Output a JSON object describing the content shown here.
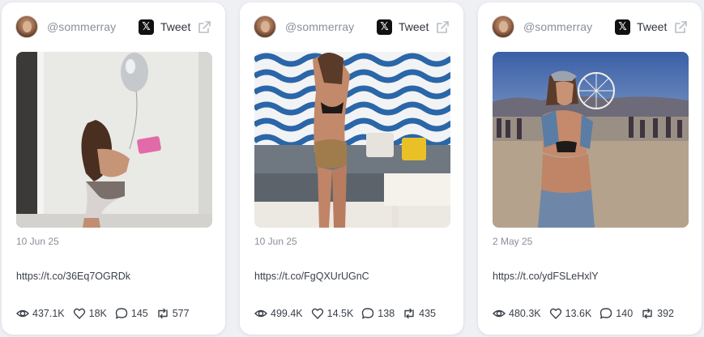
{
  "cards": [
    {
      "handle": "@sommerray",
      "tweet_label": "Tweet",
      "date": "10 Jun 25",
      "link": "https://t.co/36Eq7OGRDk",
      "views": "437.1K",
      "likes": "18K",
      "replies": "145",
      "retweets": "577",
      "photo_theme": "white-wall-balloon"
    },
    {
      "handle": "@sommerray",
      "tweet_label": "Tweet",
      "date": "10 Jun 25",
      "link": "https://t.co/FgQXUrUGnC",
      "views": "499.4K",
      "likes": "14.5K",
      "replies": "138",
      "retweets": "435",
      "photo_theme": "blue-wave-wall-lounge"
    },
    {
      "handle": "@sommerray",
      "tweet_label": "Tweet",
      "date": "2 May 25",
      "link": "https://t.co/ydFSLeHxlY",
      "views": "480.3K",
      "likes": "13.6K",
      "replies": "140",
      "retweets": "392",
      "photo_theme": "festival-ferris-wheel"
    }
  ],
  "icons": {
    "x_logo": "𝕏",
    "views": "eye-icon",
    "likes": "heart-icon",
    "replies": "comment-icon",
    "retweets": "retweet-icon",
    "external": "external-link-icon"
  },
  "colors": {
    "background": "#eef0f4",
    "card": "#ffffff",
    "muted_text": "#8a8f99",
    "body_text": "#3a3f48"
  }
}
